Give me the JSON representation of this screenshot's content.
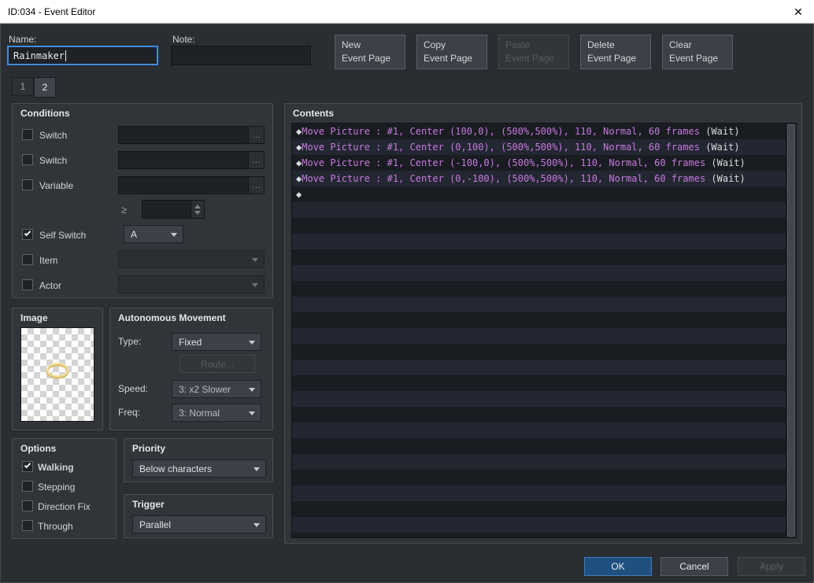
{
  "window": {
    "title": "ID:034 - Event Editor",
    "close_glyph": "✕"
  },
  "colors": {
    "command_text": "#c678dd",
    "accent_focus": "#3f8cdf",
    "ok_fill": "#20507f",
    "ok_border": "#3e7cbd"
  },
  "header": {
    "name_label": "Name:",
    "name_value": "Rainmaker",
    "note_label": "Note:",
    "note_value": "",
    "page_buttons": [
      {
        "label": "New\nEvent Page",
        "enabled": true
      },
      {
        "label": "Copy\nEvent Page",
        "enabled": true
      },
      {
        "label": "Paste\nEvent Page",
        "enabled": false
      },
      {
        "label": "Delete\nEvent Page",
        "enabled": true
      },
      {
        "label": "Clear\nEvent Page",
        "enabled": true
      }
    ]
  },
  "tabs": [
    {
      "label": "1",
      "active": false
    },
    {
      "label": "2",
      "active": true
    }
  ],
  "conditions": {
    "title": "Conditions",
    "ellipsis": "…",
    "rows": {
      "switch1": {
        "label": "Switch",
        "checked": false,
        "value": ""
      },
      "switch2": {
        "label": "Switch",
        "checked": false,
        "value": ""
      },
      "variable": {
        "label": "Variable",
        "checked": false,
        "value": ""
      },
      "gte": {
        "label": "≥",
        "value": ""
      },
      "self_switch": {
        "label": "Self Switch",
        "checked": true,
        "value": "A"
      },
      "item": {
        "label": "Item",
        "checked": false,
        "value": ""
      },
      "actor": {
        "label": "Actor",
        "checked": false,
        "value": ""
      }
    }
  },
  "image": {
    "title": "Image"
  },
  "movement": {
    "title": "Autonomous Movement",
    "type_label": "Type:",
    "type_value": "Fixed",
    "route_button": "Route...",
    "speed_label": "Speed:",
    "speed_value": "3: x2 Slower",
    "freq_label": "Freq:",
    "freq_value": "3: Normal"
  },
  "options": {
    "title": "Options",
    "items": [
      {
        "label": "Walking",
        "checked": true
      },
      {
        "label": "Stepping",
        "checked": false
      },
      {
        "label": "Direction Fix",
        "checked": false
      },
      {
        "label": "Through",
        "checked": false
      }
    ]
  },
  "priority": {
    "title": "Priority",
    "value": "Below characters"
  },
  "trigger": {
    "title": "Trigger",
    "value": "Parallel"
  },
  "contents": {
    "title": "Contents",
    "lines": [
      {
        "bullet": "◆",
        "command": "Move Picture : #1, Center (100,0), (500%,500%), 110, Normal, 60 frames",
        "suffix": " (Wait)"
      },
      {
        "bullet": "◆",
        "command": "Move Picture : #1, Center (0,100), (500%,500%), 110, Normal, 60 frames",
        "suffix": " (Wait)"
      },
      {
        "bullet": "◆",
        "command": "Move Picture : #1, Center (-100,0), (500%,500%), 110, Normal, 60 frames",
        "suffix": " (Wait)"
      },
      {
        "bullet": "◆",
        "command": "Move Picture : #1, Center (0,-100), (500%,500%), 110, Normal, 60 frames",
        "suffix": " (Wait)"
      },
      {
        "bullet": "◆",
        "command": "",
        "suffix": ""
      }
    ]
  },
  "footer": {
    "ok": "OK",
    "cancel": "Cancel",
    "apply": "Apply"
  }
}
